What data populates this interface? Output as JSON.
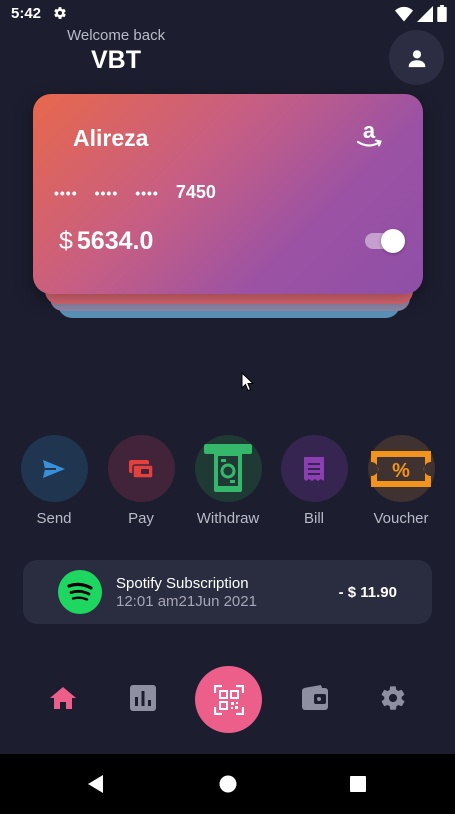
{
  "status_bar": {
    "time": "5:42"
  },
  "header": {
    "welcome": "Welcome back",
    "username": "VBT"
  },
  "card": {
    "holder": "Alireza",
    "brand_icon": "amazon-icon",
    "masked_groups": [
      "••••",
      "••••",
      "••••"
    ],
    "last_four": "7450",
    "currency": "$",
    "balance": "5634.0",
    "toggle_on": true
  },
  "actions": [
    {
      "label": "Send",
      "icon": "send-icon",
      "color": "#3a8fd9",
      "bg": "#1f3550"
    },
    {
      "label": "Pay",
      "icon": "payment-icon",
      "color": "#e3413e",
      "bg": "#42243a"
    },
    {
      "label": "Withdraw",
      "icon": "cash-withdraw-icon",
      "color": "#35b86b",
      "bg": "#1f3a35"
    },
    {
      "label": "Bill",
      "icon": "receipt-icon",
      "color": "#8b3fb2",
      "bg": "#352550"
    },
    {
      "label": "Voucher",
      "icon": "ticket-percent-icon",
      "color": "#f2931b",
      "bg": "#3f3230"
    }
  ],
  "transaction": {
    "title": "Spotify Subscription",
    "date": "12:01 am21Jun 2021",
    "amount": "- $ 11.90"
  },
  "nav": {
    "active_color": "#ec5f8a",
    "inactive_color": "#8e8fa0"
  }
}
